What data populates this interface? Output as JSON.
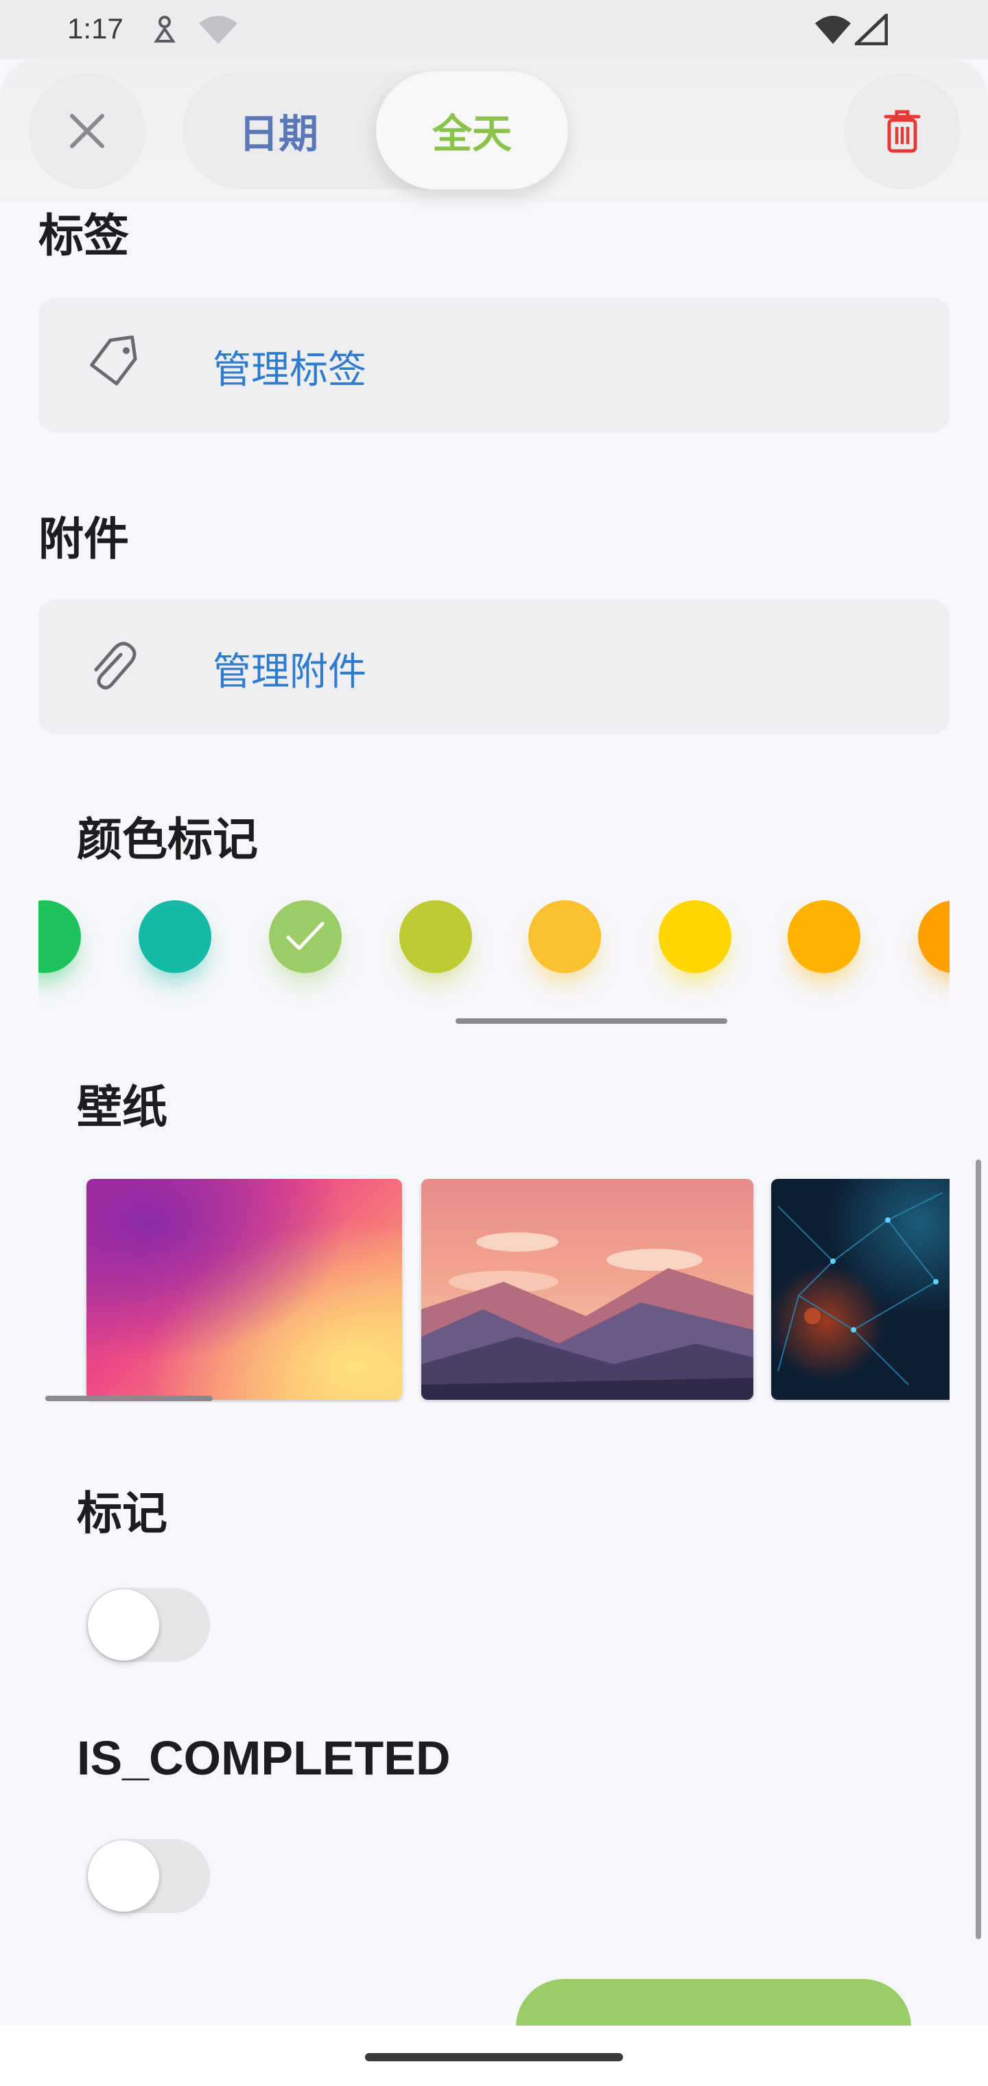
{
  "status_bar": {
    "time": "1:17"
  },
  "header": {
    "close_icon": "close-icon",
    "segments": [
      {
        "label": "日期",
        "color": "#5a78b8",
        "selected": false
      },
      {
        "label": "全天",
        "color": "#8bc34a",
        "selected": true
      }
    ],
    "delete_icon": "trash-icon",
    "delete_color": "#e53935"
  },
  "tags": {
    "title": "标签",
    "action_label": "管理标签",
    "icon": "tag-icon"
  },
  "attachments": {
    "title": "附件",
    "action_label": "管理附件",
    "icon": "paperclip-icon"
  },
  "color_mark": {
    "title": "颜色标记",
    "selected_index": 2,
    "colors": [
      "#1ec25b",
      "#16b8a6",
      "#9ccc65",
      "#c0ca33",
      "#fbc02d",
      "#ffd600",
      "#ffb300",
      "#ffa000"
    ]
  },
  "wallpaper": {
    "title": "壁纸",
    "items": [
      "pink-gradient-wallpaper",
      "sunset-mountains-wallpaper",
      "network-dark-wallpaper"
    ]
  },
  "flag": {
    "title": "标记",
    "enabled": false
  },
  "completed": {
    "title": "IS_COMPLETED",
    "enabled": false
  },
  "accent": "#9ccc65"
}
